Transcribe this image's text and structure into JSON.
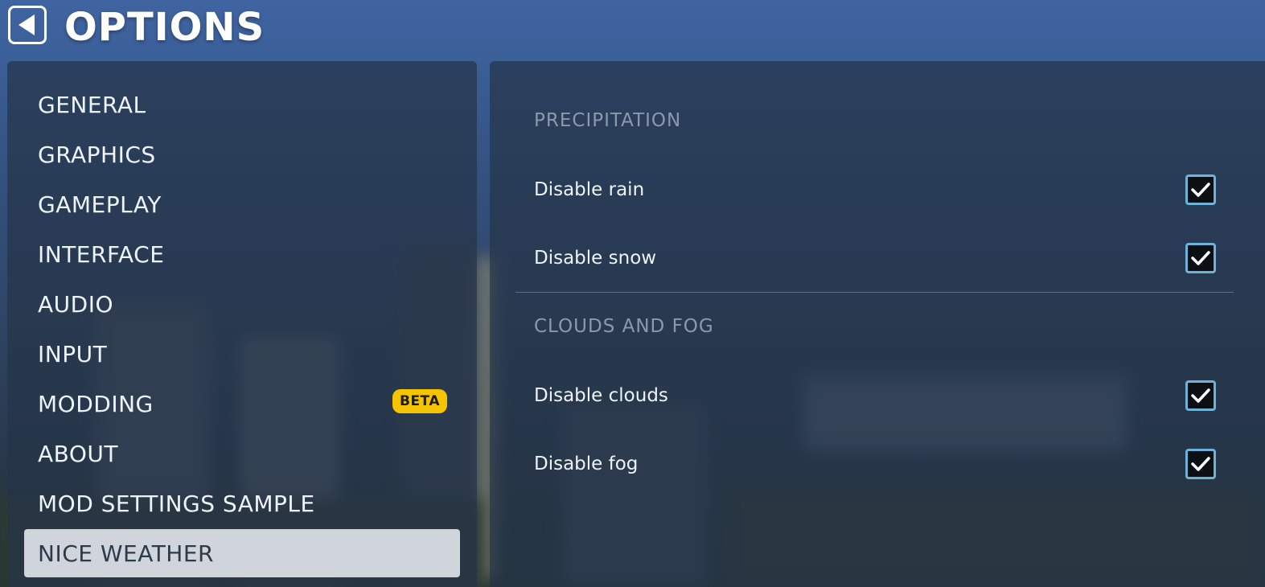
{
  "header": {
    "title": "OPTIONS",
    "back_icon": "back-arrow-icon"
  },
  "sidebar": {
    "items": [
      {
        "label": "GENERAL",
        "active": false
      },
      {
        "label": "GRAPHICS",
        "active": false
      },
      {
        "label": "GAMEPLAY",
        "active": false
      },
      {
        "label": "INTERFACE",
        "active": false
      },
      {
        "label": "AUDIO",
        "active": false
      },
      {
        "label": "INPUT",
        "active": false
      },
      {
        "label": "MODDING",
        "active": false,
        "badge": "BETA"
      },
      {
        "label": "ABOUT",
        "active": false
      },
      {
        "label": "MOD SETTINGS SAMPLE",
        "active": false
      },
      {
        "label": "NICE WEATHER",
        "active": true
      }
    ]
  },
  "content": {
    "sections": [
      {
        "header": "PRECIPITATION",
        "options": [
          {
            "label": "Disable rain",
            "checked": true
          },
          {
            "label": "Disable snow",
            "checked": true
          }
        ]
      },
      {
        "header": "CLOUDS AND FOG",
        "options": [
          {
            "label": "Disable clouds",
            "checked": true
          },
          {
            "label": "Disable fog",
            "checked": true
          }
        ]
      }
    ]
  },
  "colors": {
    "badge": "#f5c400",
    "checkbox_border": "#6db2d8",
    "active_item_bg": "#e8ecf0"
  }
}
